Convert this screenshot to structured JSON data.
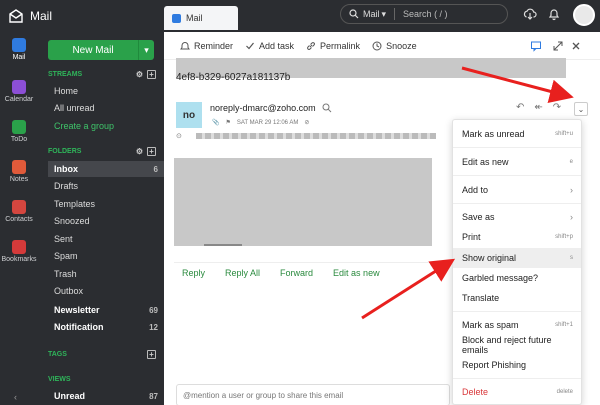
{
  "app": {
    "name": "Mail"
  },
  "tab": {
    "label": "Mail"
  },
  "search": {
    "mode": "Mail",
    "placeholder": "Search ( / )"
  },
  "rail": {
    "items": [
      {
        "label": "Mail",
        "icon": "mail-icon",
        "color": "#2f7be0"
      },
      {
        "label": "Calendar",
        "icon": "calendar-icon",
        "color": "#8c4fd6"
      },
      {
        "label": "ToDo",
        "icon": "todo-icon",
        "color": "#2aa14a"
      },
      {
        "label": "Notes",
        "icon": "notes-icon",
        "color": "#e05a3a"
      },
      {
        "label": "Contacts",
        "icon": "contacts-icon",
        "color": "#d4463f"
      },
      {
        "label": "Bookmarks",
        "icon": "bookmark-icon",
        "color": "#d43a3a"
      }
    ],
    "collapse": "‹"
  },
  "sidebar": {
    "new_mail": "New Mail",
    "streams_title": "STREAMS",
    "streams": [
      {
        "label": "Home"
      },
      {
        "label": "All unread"
      },
      {
        "label": "Create a group"
      }
    ],
    "folders_title": "FOLDERS",
    "folders": [
      {
        "label": "Inbox",
        "count": "6"
      },
      {
        "label": "Drafts",
        "count": ""
      },
      {
        "label": "Templates",
        "count": ""
      },
      {
        "label": "Snoozed",
        "count": ""
      },
      {
        "label": "Sent",
        "count": ""
      },
      {
        "label": "Spam",
        "count": ""
      },
      {
        "label": "Trash",
        "count": ""
      },
      {
        "label": "Outbox",
        "count": ""
      },
      {
        "label": "Newsletter",
        "count": "69"
      },
      {
        "label": "Notification",
        "count": "12"
      }
    ],
    "tags_title": "TAGS",
    "views_title": "VIEWS",
    "views": [
      {
        "label": "Unread",
        "count": "87"
      }
    ]
  },
  "toolbar": {
    "reminder": "Reminder",
    "add_task": "Add task",
    "permalink": "Permalink",
    "snooze": "Snooze"
  },
  "message": {
    "id_fragment": "4ef8-b329-6027a181137b",
    "avatar_initials": "no",
    "sender": "noreply-dmarc@zoho.com",
    "date": "SAT MAR 29 12:06 AM",
    "to_fragment": "0787b548b7...063a2f4c963e47aab352006112094395...to..."
  },
  "reply_bar": {
    "reply": "Reply",
    "reply_all": "Reply All",
    "forward": "Forward",
    "edit_as_new": "Edit as new"
  },
  "mention_placeholder": "@mention a user or group to share this email",
  "menu": {
    "items": [
      {
        "label": "Mark as unread",
        "shortcut": "shift+u",
        "submenu": false,
        "danger": false
      },
      {
        "label": "Edit as new",
        "shortcut": "e",
        "submenu": false,
        "danger": false
      },
      {
        "label": "Add to",
        "shortcut": "",
        "submenu": true,
        "danger": false
      },
      {
        "label": "Save as",
        "shortcut": "",
        "submenu": true,
        "danger": false
      },
      {
        "label": "Print",
        "shortcut": "shift+p",
        "submenu": false,
        "danger": false
      },
      {
        "label": "Show original",
        "shortcut": "s",
        "submenu": false,
        "danger": false
      },
      {
        "label": "Garbled message?",
        "shortcut": "",
        "submenu": false,
        "danger": false
      },
      {
        "label": "Translate",
        "shortcut": "",
        "submenu": false,
        "danger": false
      },
      {
        "label": "Mark as spam",
        "shortcut": "shift+1",
        "submenu": false,
        "danger": false
      },
      {
        "label": "Block and reject future emails",
        "shortcut": "",
        "submenu": false,
        "danger": false
      },
      {
        "label": "Report Phishing",
        "shortcut": "",
        "submenu": false,
        "danger": false
      },
      {
        "label": "Delete",
        "shortcut": "delete",
        "submenu": false,
        "danger": true
      }
    ],
    "highlighted": "Show original"
  },
  "colors": {
    "accent_green": "#2aa14a",
    "annotation_red": "#e8201e",
    "dark_chrome": "#2b2d31",
    "danger": "#d9373a"
  }
}
